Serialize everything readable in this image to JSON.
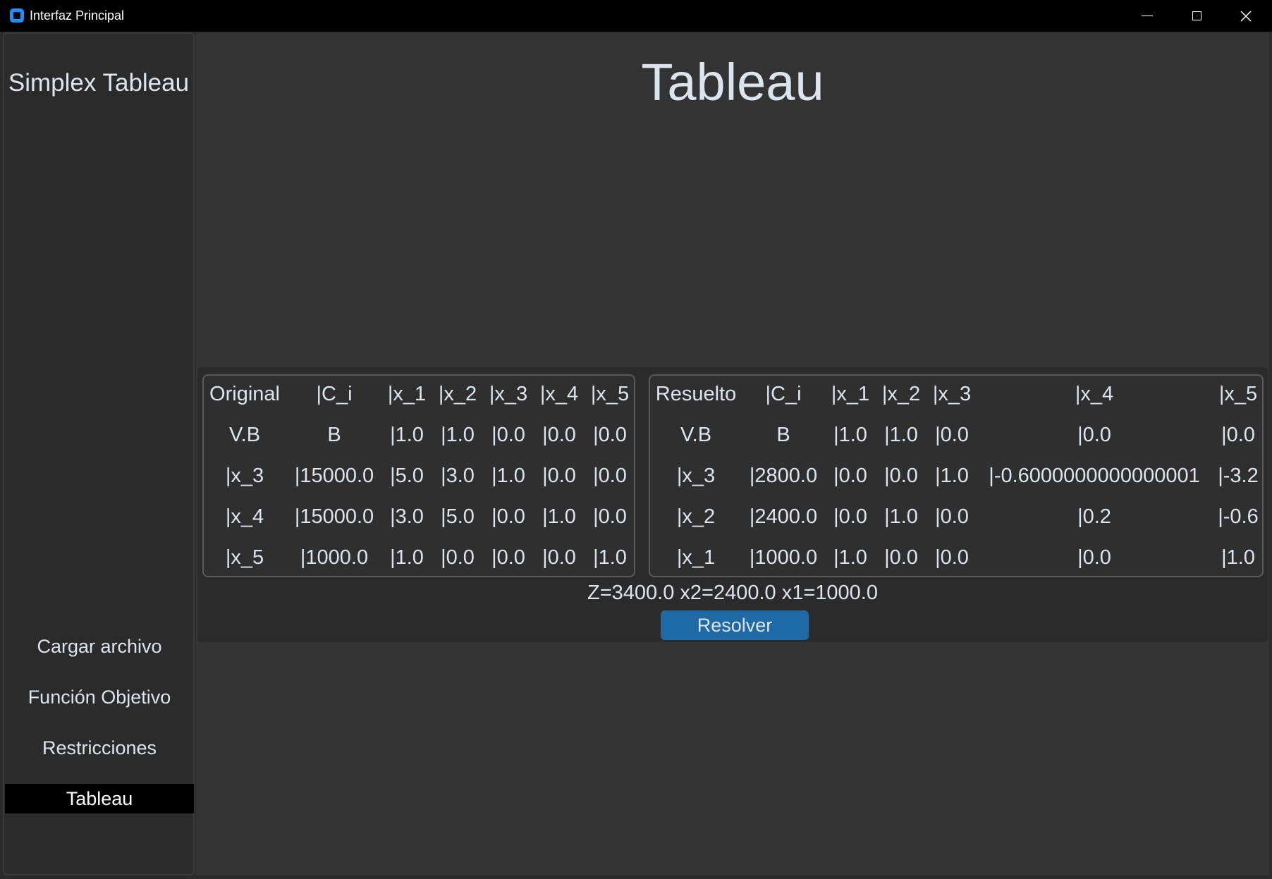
{
  "window": {
    "title": "Interfaz Principal"
  },
  "sidebar": {
    "title": "Simplex Tableau",
    "items": [
      {
        "label": "Cargar archivo"
      },
      {
        "label": "Función Objetivo"
      },
      {
        "label": "Restricciones"
      },
      {
        "label": "Tableau",
        "active": true
      }
    ]
  },
  "main": {
    "title": "Tableau",
    "original": {
      "rows": [
        [
          "Original",
          "|C_i",
          "|x_1",
          "|x_2",
          "|x_3",
          "|x_4",
          "|x_5"
        ],
        [
          "V.B",
          "B",
          "|1.0",
          "|1.0",
          "|0.0",
          "|0.0",
          "|0.0"
        ],
        [
          "|x_3",
          "|15000.0",
          "|5.0",
          "|3.0",
          "|1.0",
          "|0.0",
          "|0.0"
        ],
        [
          "|x_4",
          "|15000.0",
          "|3.0",
          "|5.0",
          "|0.0",
          "|1.0",
          "|0.0"
        ],
        [
          "|x_5",
          "|1000.0",
          "|1.0",
          "|0.0",
          "|0.0",
          "|0.0",
          "|1.0"
        ]
      ]
    },
    "resolved": {
      "rows": [
        [
          "Resuelto",
          "|C_i",
          "|x_1",
          "|x_2",
          "|x_3",
          "|x_4",
          "|x_5"
        ],
        [
          "V.B",
          "B",
          "|1.0",
          "|1.0",
          "|0.0",
          "|0.0",
          "|0.0"
        ],
        [
          "|x_3",
          "|2800.0",
          "|0.0",
          "|0.0",
          "|1.0",
          "|-0.6000000000000001",
          "|-3.2"
        ],
        [
          "|x_2",
          "|2400.0",
          "|0.0",
          "|1.0",
          "|0.0",
          "|0.2",
          "|-0.6"
        ],
        [
          "|x_1",
          "|1000.0",
          "|1.0",
          "|0.0",
          "|0.0",
          "|0.0",
          "|1.0"
        ]
      ]
    },
    "summary": "Z=3400.0 x2=2400.0 x1=1000.0",
    "resolve_label": "Resolver"
  }
}
